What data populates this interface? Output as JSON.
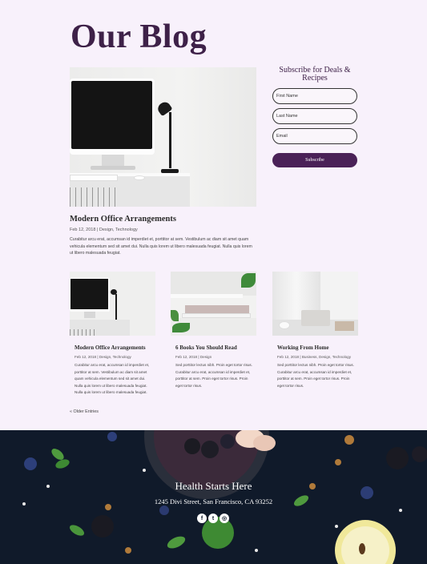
{
  "page": {
    "title": "Our Blog"
  },
  "featured_post": {
    "title": "Modern Office Arrangements",
    "meta": "Feb 12, 2018 | Design, Technology",
    "excerpt": "Curabitur arcu erat, accumsan id imperdiet et, porttitor at sem. Vestibulum ac diam sit amet quam vehicula elementum sed sit amet dui. Nulla quis lorem ut libero malesuada feugiat. Nulla quis lorem ut libero malesuada feugiat."
  },
  "subscribe": {
    "title": "Subscribe for Deals & Recipes",
    "first_name_placeholder": "First Name",
    "last_name_placeholder": "Last Name",
    "email_placeholder": "Email",
    "button_label": "Subscribe"
  },
  "posts": [
    {
      "title": "Modern Office Arrangements",
      "meta": "Feb 12, 2018 | Design, Technology",
      "excerpt": "Curabitur arcu erat, accumsan id imperdiet et, porttitor at sem. Vestibulum ac diam sit amet quam vehicula elementum sed sit amet dui. Nulla quis lorem ut libero malesuada feugiat. Nulla quis lorem ut libero malesuada feugiat."
    },
    {
      "title": "6 Books You Should Read",
      "meta": "Feb 12, 2018 | Design",
      "excerpt": "Sed porttitor lectus nibh. Proin eget tortor risus. Curabitur arcu erat, accumsan id imperdiet et, porttitor at sem. Proin eget tortor risus. Proin eget tortor risus."
    },
    {
      "title": "Working From Home",
      "meta": "Feb 12, 2018 | Business, Design, Technology",
      "excerpt": "Sed porttitor lectus nibh. Proin eget tortor risus. Curabitur arcu erat, accumsan id imperdiet et, porttitor at sem. Proin eget tortor risus. Proin eget tortor risus."
    }
  ],
  "pagination": {
    "older_label": "« Older Entries"
  },
  "footer": {
    "title": "Health Starts Here",
    "address": "1245 Divi Street, San Francisco, CA 93252",
    "social": [
      {
        "icon": "facebook-icon",
        "glyph": "f"
      },
      {
        "icon": "twitter-icon",
        "glyph": "t"
      },
      {
        "icon": "instagram-icon",
        "glyph": "◎"
      }
    ]
  },
  "colors": {
    "accent": "#4a2157",
    "title": "#3e2148",
    "background": "#f8f1fb",
    "footer": "#101a2a"
  }
}
